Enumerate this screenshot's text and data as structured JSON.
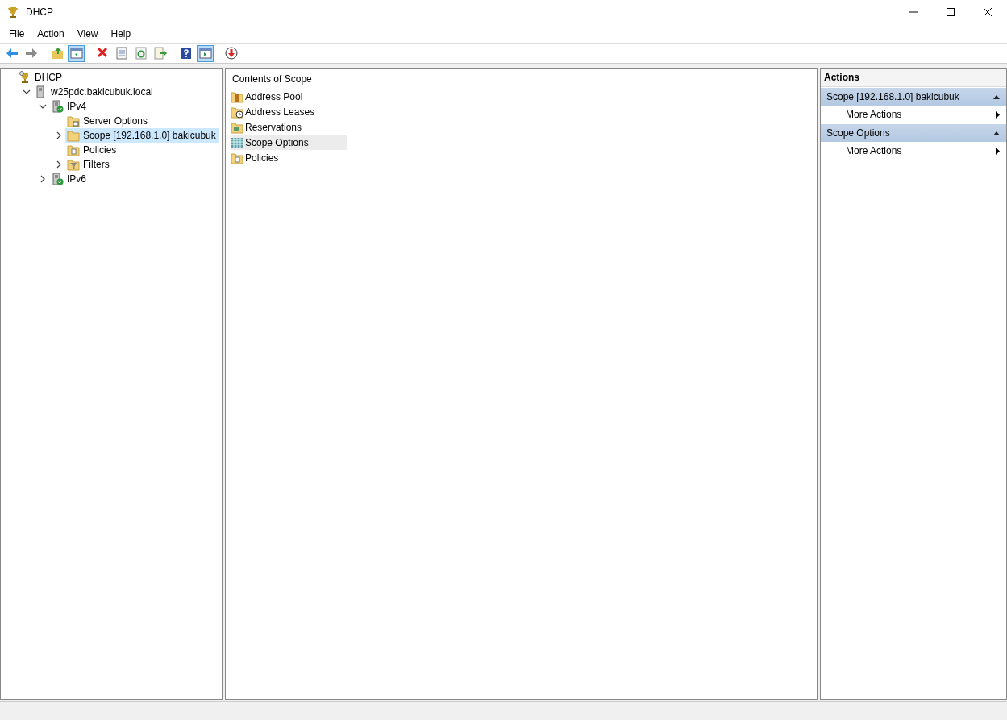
{
  "window": {
    "title": "DHCP"
  },
  "menu": [
    "File",
    "Action",
    "View",
    "Help"
  ],
  "toolbar": [
    [
      {
        "kind": "back",
        "pressed": false
      },
      {
        "kind": "forward",
        "pressed": false
      }
    ],
    [
      {
        "kind": "up",
        "pressed": false
      },
      {
        "kind": "tree",
        "pressed": true
      }
    ],
    [
      {
        "kind": "delete",
        "pressed": false
      },
      {
        "kind": "properties",
        "pressed": false
      },
      {
        "kind": "refresh",
        "pressed": false
      },
      {
        "kind": "export",
        "pressed": false
      }
    ],
    [
      {
        "kind": "help",
        "pressed": false
      },
      {
        "kind": "actionpane",
        "pressed": true
      }
    ],
    [
      {
        "kind": "stop",
        "pressed": false
      }
    ]
  ],
  "tree": [
    {
      "label": "DHCP",
      "kind": "dhcp",
      "selected": false,
      "children": [
        {
          "label": "w25pdc.bakicubuk.local",
          "kind": "server",
          "selected": false,
          "expanded": true,
          "children": [
            {
              "label": "IPv4",
              "kind": "server-ok",
              "selected": false,
              "expanded": true,
              "children": [
                {
                  "label": "Server Options",
                  "kind": "options",
                  "selected": false
                },
                {
                  "label": "Scope [192.168.1.0] bakicubuk",
                  "kind": "folder",
                  "selected": true,
                  "expanded": false
                },
                {
                  "label": "Policies",
                  "kind": "policy",
                  "selected": false
                },
                {
                  "label": "Filters",
                  "kind": "filter",
                  "selected": false,
                  "expanded": false
                }
              ]
            },
            {
              "label": "IPv6",
              "kind": "server-ok",
              "selected": false,
              "expanded": false
            }
          ]
        }
      ]
    }
  ],
  "contents": {
    "title": "Contents of Scope",
    "items": [
      {
        "label": "Address Pool",
        "kind": "pool",
        "selected": false
      },
      {
        "label": "Address Leases",
        "kind": "leases",
        "selected": false
      },
      {
        "label": "Reservations",
        "kind": "reservations",
        "selected": false
      },
      {
        "label": "Scope Options",
        "kind": "scope-options",
        "selected": true
      },
      {
        "label": "Policies",
        "kind": "policy",
        "selected": false
      }
    ]
  },
  "actions": {
    "title": "Actions",
    "sections": [
      {
        "title": "Scope [192.168.1.0] bakicubuk",
        "expanded": true,
        "items": [
          "More Actions"
        ]
      },
      {
        "title": "Scope Options",
        "expanded": true,
        "items": [
          "More Actions"
        ]
      }
    ]
  }
}
